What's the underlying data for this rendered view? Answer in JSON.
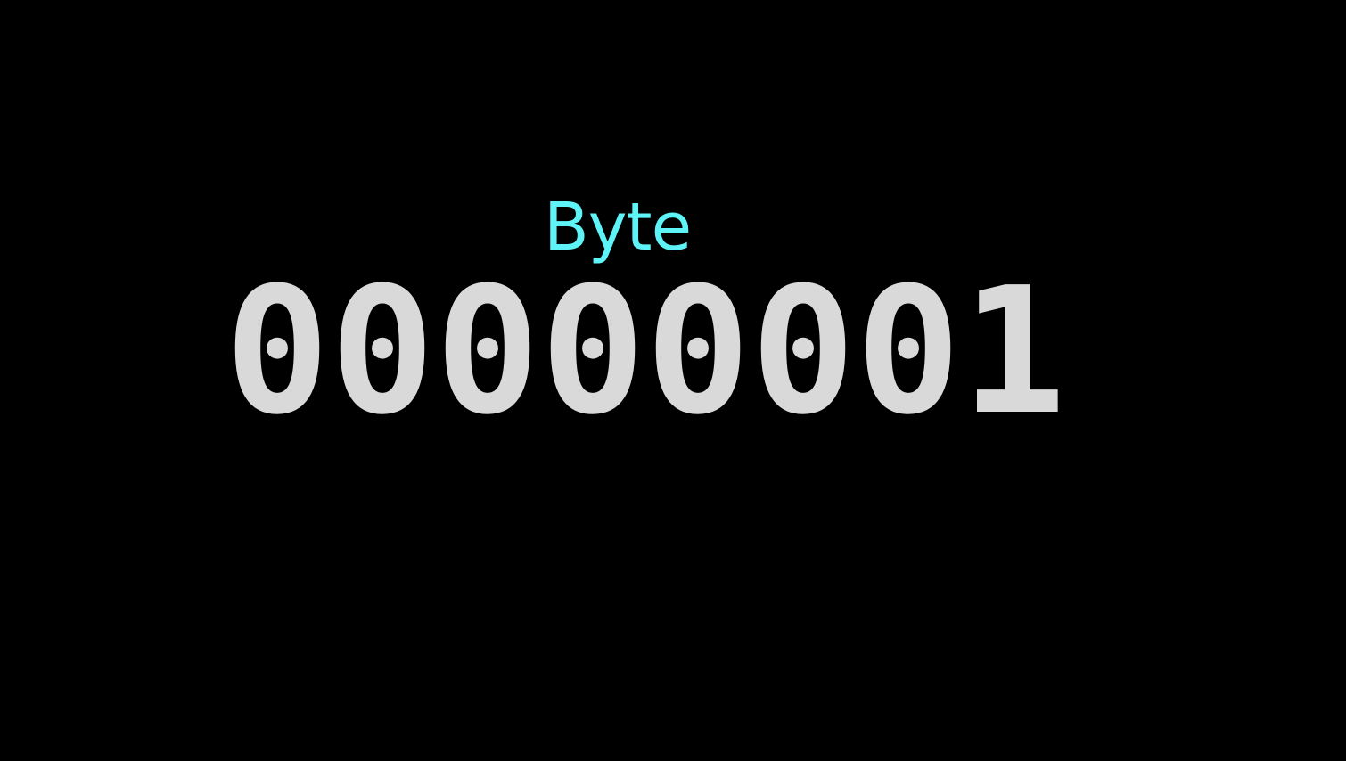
{
  "label": "Byte",
  "bits": "00000001",
  "colors": {
    "background": "#000000",
    "label": "#5ef3f7",
    "bits": "#d9d9d9"
  }
}
